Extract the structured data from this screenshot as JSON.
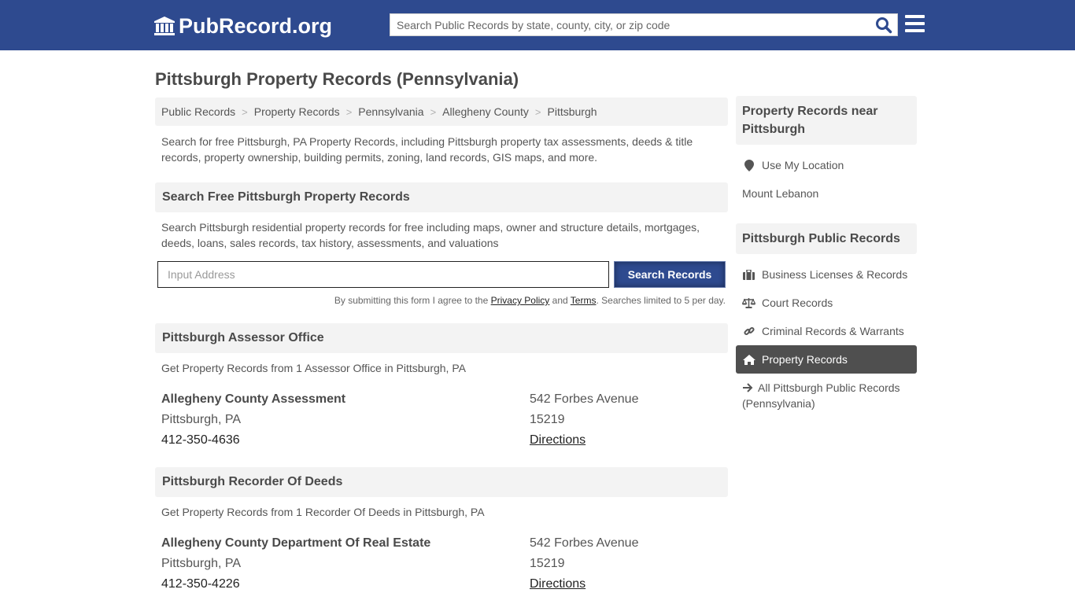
{
  "header": {
    "logo_text": "PubRecord.org",
    "search_placeholder": "Search Public Records by state, county, city, or zip code",
    "brand_color": "#2e4a8f"
  },
  "page": {
    "title": "Pittsburgh Property Records (Pennsylvania)",
    "breadcrumb": [
      "Public Records",
      "Property Records",
      "Pennsylvania",
      "Allegheny County",
      "Pittsburgh"
    ],
    "intro": "Search for free Pittsburgh, PA Property Records, including Pittsburgh property tax assessments, deeds & title records, property ownership, building permits, zoning, land records, GIS maps, and more."
  },
  "search_form": {
    "heading": "Search Free Pittsburgh Property Records",
    "description": "Search Pittsburgh residential property records for free including maps, owner and structure details, mortgages, deeds, loans, sales records, tax history, assessments, and valuations",
    "input_placeholder": "Input Address",
    "button_label": "Search Records",
    "disclaimer_prefix": "By submitting this form I agree to the ",
    "privacy_label": "Privacy Policy",
    "disclaimer_and": " and ",
    "terms_label": "Terms",
    "disclaimer_suffix": ". Searches limited to 5 per day."
  },
  "sections": [
    {
      "heading": "Pittsburgh Assessor Office",
      "description": "Get Property Records from 1 Assessor Office in Pittsburgh, PA",
      "office": {
        "name": "Allegheny County Assessment",
        "city": "Pittsburgh, PA",
        "phone": "412-350-4636",
        "address": "542 Forbes Avenue",
        "zip": "15219",
        "directions_label": "Directions"
      }
    },
    {
      "heading": "Pittsburgh Recorder Of Deeds",
      "description": "Get Property Records from 1 Recorder Of Deeds in Pittsburgh, PA",
      "office": {
        "name": "Allegheny County Department Of Real Estate",
        "city": "Pittsburgh, PA",
        "phone": "412-350-4226",
        "address": "542 Forbes Avenue",
        "zip": "15219",
        "directions_label": "Directions"
      }
    }
  ],
  "sidebar": {
    "nearby_heading": "Property Records near Pittsburgh",
    "use_location_label": "Use My Location",
    "nearby": [
      "Mount Lebanon"
    ],
    "public_heading": "Pittsburgh Public Records",
    "links": [
      {
        "label": "Business Licenses & Records",
        "icon": "briefcase-icon",
        "active": false
      },
      {
        "label": "Court Records",
        "icon": "scale-icon",
        "active": false
      },
      {
        "label": "Criminal Records & Warrants",
        "icon": "link-icon",
        "active": false
      },
      {
        "label": "Property Records",
        "icon": "home-icon",
        "active": true
      }
    ],
    "all_records_label": "All Pittsburgh Public Records (Pennsylvania)"
  }
}
